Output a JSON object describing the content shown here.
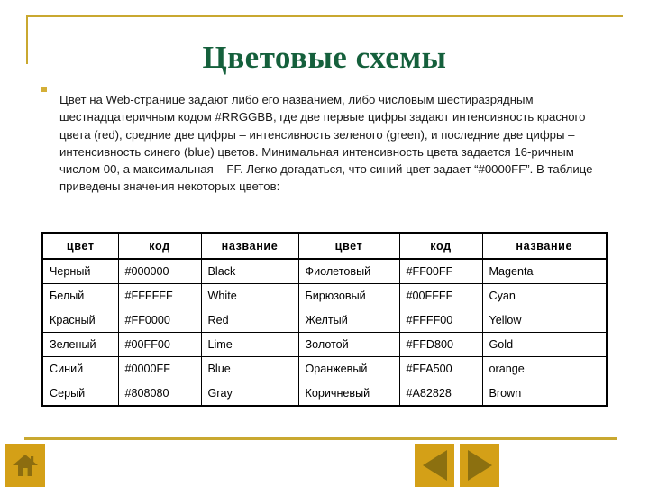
{
  "slide": {
    "title": "Цветовые схемы",
    "body_text": "Цвет на Web-странице задают либо его названием, либо числовым шестиразрядным шестнадцатеричным кодом #RRGGBB, где две первые цифры задают интенсивность красного цвета (red), средние две цифры – интенсивность зеленого (green), и последние две цифры – интенсивность синего (blue) цветов. Минимальная интенсивность цвета задается 16-ричным числом 00, а максимальная – FF. Легко догадаться, что синий цвет задает “#0000FF”. В таблице приведены значения некоторых цветов:",
    "title_color": "#15603c",
    "accent_color": "#c9a830",
    "nav_button_color": "#d4a017"
  },
  "table": {
    "headers": [
      "цвет",
      "код",
      "название",
      "цвет",
      "код",
      "название"
    ],
    "rows": [
      [
        "Черный",
        "#000000",
        "Black",
        "Фиолетовый",
        "#FF00FF",
        "Magenta"
      ],
      [
        "Белый",
        "#FFFFFF",
        "White",
        "Бирюзовый",
        "#00FFFF",
        "Cyan"
      ],
      [
        "Красный",
        "#FF0000",
        "Red",
        "Желтый",
        "#FFFF00",
        "Yellow"
      ],
      [
        "Зеленый",
        "#00FF00",
        "Lime",
        "Золотой",
        "#FFD800",
        "Gold"
      ],
      [
        "Синий",
        "#0000FF",
        "Blue",
        "Оранжевый",
        "#FFA500",
        "orange"
      ],
      [
        "Серый",
        "#808080",
        "Gray",
        "Коричневый",
        "#A82828",
        "Brown"
      ]
    ]
  },
  "navigation": {
    "home_label": "home-icon",
    "prev_label": "previous-slide",
    "next_label": "next-slide"
  }
}
